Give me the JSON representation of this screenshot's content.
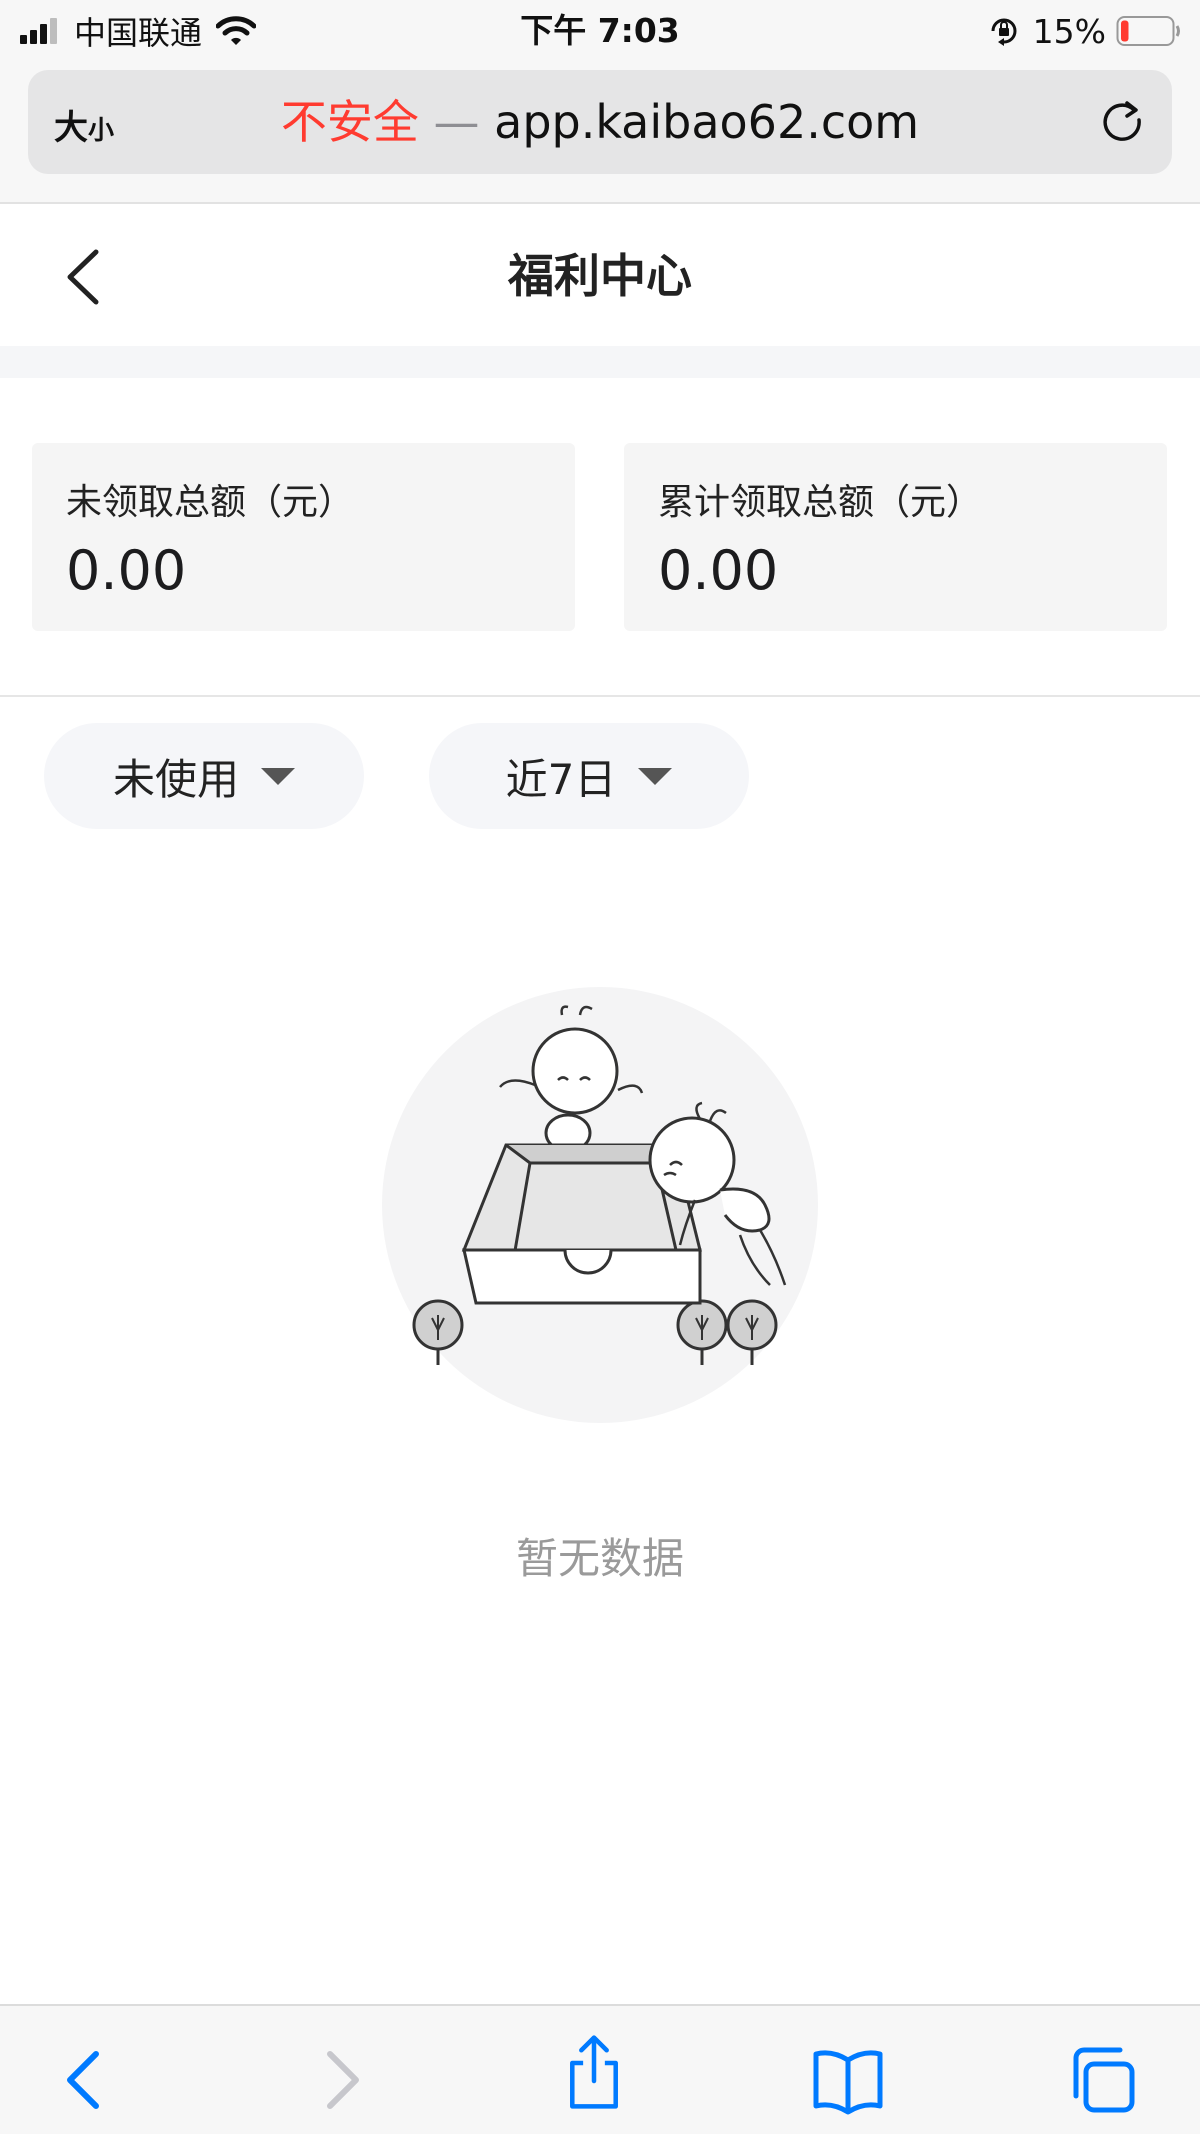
{
  "status_bar": {
    "carrier": "中国联通",
    "time": "下午 7:03",
    "battery_percent": "15%",
    "battery_level": 0.15,
    "battery_color": "#ff3b30"
  },
  "browser": {
    "text_size_label": "大",
    "text_size_label_small": "小",
    "security_label": "不安全",
    "separator": "—",
    "domain": "app.kaibao62.com",
    "accent_color": "#007aff",
    "icons": [
      "text-size-icon",
      "reload-icon",
      "back-icon",
      "forward-icon",
      "share-icon",
      "bookmarks-icon",
      "tabs-icon"
    ]
  },
  "header": {
    "title": "福利中心"
  },
  "summary": {
    "unclaimed_label": "未领取总额（元）",
    "unclaimed_value": "0.00",
    "claimed_label": "累计领取总额（元）",
    "claimed_value": "0.00"
  },
  "filters": {
    "status_selected": "未使用",
    "range_selected": "近7日"
  },
  "empty_state": {
    "text": "暂无数据"
  }
}
